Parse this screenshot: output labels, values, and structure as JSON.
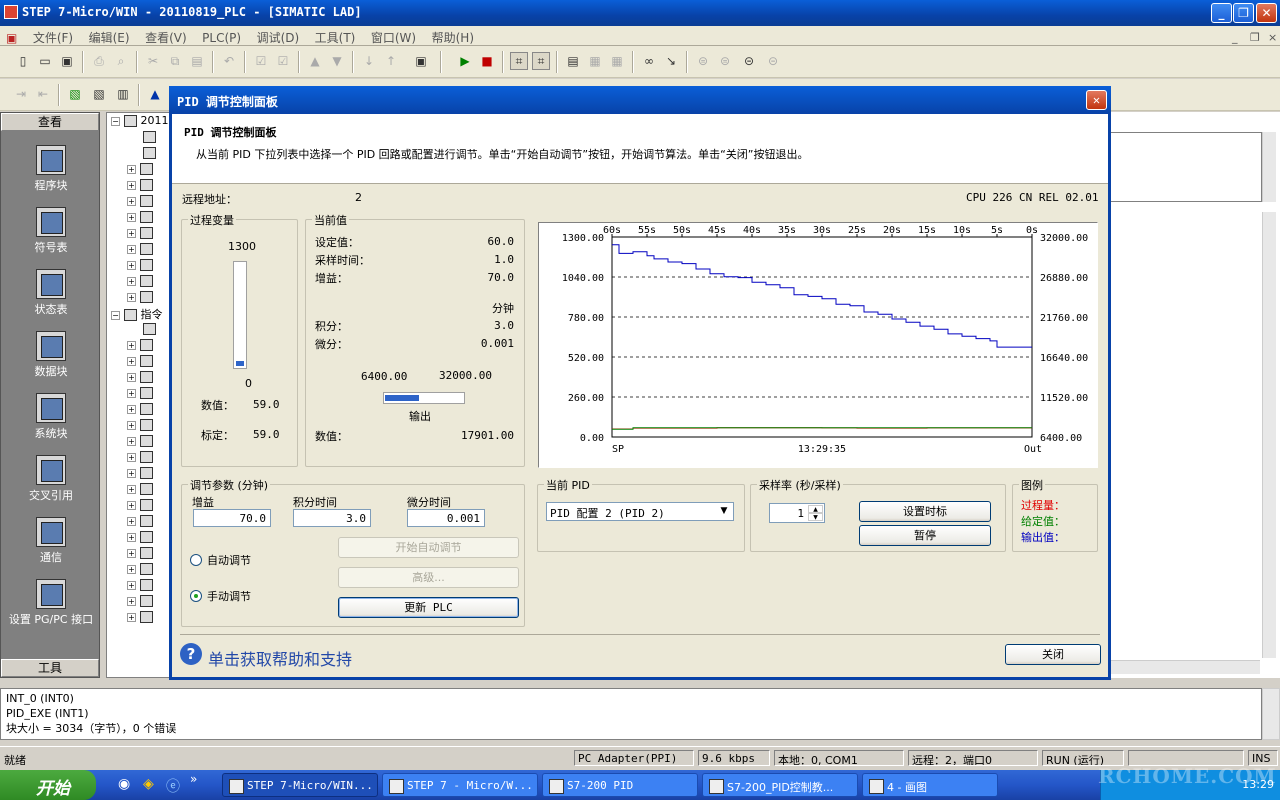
{
  "window": {
    "title": "STEP 7-Micro/WIN - 20110819_PLC - [SIMATIC LAD]",
    "min": "_",
    "max": "❐",
    "close": "✕"
  },
  "menu": {
    "items": [
      "文件(F)",
      "编辑(E)",
      "查看(V)",
      "PLC(P)",
      "调试(D)",
      "工具(T)",
      "窗口(W)",
      "帮助(H)"
    ],
    "mdi_min": "_",
    "mdi_restore": "❐",
    "mdi_close": "×"
  },
  "navbar": {
    "header": "查看",
    "footer": "工具",
    "items": [
      "程序块",
      "符号表",
      "状态表",
      "数据块",
      "系统块",
      "交叉引用",
      "通信",
      "设置 PG/PC 接口"
    ]
  },
  "tree": {
    "root": "2011",
    "row2": "指令"
  },
  "dialog": {
    "title": "PID 调节控制面板",
    "close": "✕",
    "header_title": "PID 调节控制面板",
    "header_desc": "从当前 PID 下拉列表中选择一个 PID 回路或配置进行调节。单击“开始自动调节”按钮，开始调节算法。单击“关闭”按钮退出。",
    "remote_label": "远程地址：",
    "remote_value": "2",
    "cpu": "CPU 226 CN REL 02.01",
    "pv": {
      "caption": "过程变量",
      "max": "1300",
      "min": "0",
      "level": 0.045,
      "value_label": "数值：",
      "value": "59.0",
      "scaled_label": "标定：",
      "scaled": "59.0"
    },
    "current": {
      "caption": "当前值",
      "setpoint_label": "设定值：",
      "setpoint": "60.0",
      "sample_label": "采样时间：",
      "sample": "1.0",
      "gain_label": "增益：",
      "gain": "70.0",
      "unit": "分钟",
      "integral_label": "积分：",
      "integral": "3.0",
      "derivative_label": "微分：",
      "derivative": "0.001",
      "out_min": "6400.00",
      "out_max": "32000.00",
      "output_label": "输出",
      "output_level": 0.44,
      "value_label": "数值：",
      "value": "17901.00"
    },
    "params": {
      "caption": "调节参数 (分钟)",
      "gain_label": "增益",
      "gain": "70.0",
      "integral_label": "积分时间",
      "integral": "3.0",
      "derivative_label": "微分时间",
      "derivative": "0.001",
      "auto_label": "自动调节",
      "manual_label": "手动调节",
      "start_auto": "开始自动调节",
      "advanced": "高级...",
      "update": "更新 PLC"
    },
    "current_pid": {
      "caption": "当前 PID",
      "selected": "PID 配置 2 (PID 2)"
    },
    "sample_rate": {
      "caption": "采样率 (秒/采样)",
      "value": "1",
      "set_time": "设置时标",
      "pause": "暂停"
    },
    "legend": {
      "caption": "图例",
      "items": [
        {
          "label": "过程量：",
          "color": "#e00000"
        },
        {
          "label": "给定值：",
          "color": "#008000"
        },
        {
          "label": "输出值：",
          "color": "#0000c0"
        }
      ]
    },
    "help": "单击获取帮助和支持",
    "close_button": "关闭"
  },
  "chart_data": {
    "type": "line",
    "x_ticks": [
      "60s",
      "55s",
      "50s",
      "45s",
      "40s",
      "35s",
      "30s",
      "25s",
      "20s",
      "15s",
      "10s",
      "5s",
      "0s"
    ],
    "ylim": [
      0,
      1300
    ],
    "y_ticks": [
      "1300.00",
      "1040.00",
      "780.00",
      "520.00",
      "260.00",
      "0.00"
    ],
    "y2lim": [
      6400,
      32000
    ],
    "y2_ticks": [
      "32000.00",
      "26880.00",
      "21760.00",
      "16640.00",
      "11520.00",
      "6400.00"
    ],
    "bottom_left": "SP",
    "bottom_center": "13:29:35",
    "bottom_right": "Out",
    "grid": true,
    "series": [
      {
        "color": "#0000c0",
        "axis": "y2",
        "x": [
          -60,
          -59,
          -57,
          -55,
          -54,
          -52,
          -50,
          -48,
          -46,
          -44,
          -42,
          -40,
          -38,
          -36,
          -34,
          -32,
          -30,
          -28,
          -26,
          -24,
          -22,
          -20,
          -18,
          -16,
          -14,
          -12,
          -10,
          -8,
          -6,
          -5,
          -3,
          0
        ],
        "values": [
          31000,
          29900,
          30100,
          29600,
          29200,
          28800,
          28600,
          27900,
          27300,
          26900,
          26800,
          26200,
          25900,
          25500,
          24600,
          24400,
          24100,
          23400,
          23200,
          22400,
          22100,
          21500,
          21100,
          20600,
          20200,
          19600,
          19300,
          19000,
          18700,
          17901,
          17901,
          17901
        ]
      },
      {
        "color": "#e00000",
        "axis": "y",
        "x": [
          -60,
          -57,
          -45,
          -30,
          -25,
          -15,
          0
        ],
        "values": [
          52,
          58,
          60,
          59,
          58,
          59,
          59
        ]
      },
      {
        "color": "#008000",
        "axis": "y",
        "x": [
          -60,
          -57,
          -25,
          0
        ],
        "values": [
          50,
          60,
          60,
          60
        ]
      }
    ]
  },
  "output_window": {
    "lines": [
      "INT_0 (INT0)",
      "PID_EXE (INT1)",
      "块大小 = 3034（字节），0 个错误"
    ]
  },
  "status": {
    "ready": "就绪",
    "adapter": "PC Adapter(PPI)",
    "baud": "9.6 kbps",
    "local": "本地：0, COM1",
    "remote": "远程：2，端口0",
    "mode": "RUN (运行)",
    "ins": "INS"
  },
  "taskbar": {
    "start": "开始",
    "tasks": [
      "STEP 7-Micro/WIN...",
      "STEP 7 - Micro/W...",
      "S7-200 PID",
      "S7-200_PID控制教...",
      "4 - 画图"
    ],
    "clock": "13:29"
  },
  "watermark": "RCHOME.COM"
}
